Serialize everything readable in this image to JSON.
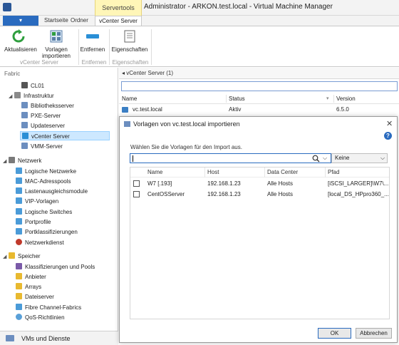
{
  "titlebar": {
    "title": "Administrator - ARKON.test.local - Virtual Machine Manager",
    "context_tab": "Servertools"
  },
  "ribbon": {
    "tabs": [
      "Startseite",
      "Ordner",
      "vCenter Server"
    ],
    "active_tab": "vCenter Server",
    "buttons": {
      "refresh": "Aktualisieren",
      "import_templates_l1": "Vorlagen",
      "import_templates_l2": "importieren",
      "remove": "Entfernen",
      "properties": "Eigenschaften"
    },
    "groups": {
      "vcenter": "vCenter Server",
      "remove": "Entfernen",
      "properties": "Eigenschaften"
    }
  },
  "nav": {
    "header": "Fabric",
    "items": [
      {
        "label": "CL01",
        "level": 2
      },
      {
        "label": "Infrastruktur",
        "level": 1
      },
      {
        "label": "Bibliotheksserver",
        "level": 2
      },
      {
        "label": "PXE-Server",
        "level": 2
      },
      {
        "label": "Updateserver",
        "level": 2
      },
      {
        "label": "vCenter Server",
        "level": 2,
        "selected": true
      },
      {
        "label": "VMM-Server",
        "level": 2
      },
      {
        "label": "Netzwerk",
        "level": 1
      },
      {
        "label": "Logische Netzwerke",
        "level": 2
      },
      {
        "label": "MAC-Adresspools",
        "level": 2
      },
      {
        "label": "Lastenausgleichsmodule",
        "level": 2
      },
      {
        "label": "VIP-Vorlagen",
        "level": 2
      },
      {
        "label": "Logische Switches",
        "level": 2
      },
      {
        "label": "Portprofile",
        "level": 2
      },
      {
        "label": "Portklassifizierungen",
        "level": 2
      },
      {
        "label": "Netzwerkdienst",
        "level": 2
      },
      {
        "label": "Speicher",
        "level": 1
      },
      {
        "label": "Klassifizierungen und Pools",
        "level": 2
      },
      {
        "label": "Anbieter",
        "level": 2
      },
      {
        "label": "Arrays",
        "level": 2
      },
      {
        "label": "Dateiserver",
        "level": 2
      },
      {
        "label": "Fibre Channel-Fabrics",
        "level": 2
      },
      {
        "label": "QoS-Richtlinien",
        "level": 2
      }
    ],
    "bottom_label": "VMs und Dienste"
  },
  "main": {
    "header": "vCenter Server (1)",
    "columns": [
      "Name",
      "Status",
      "Version"
    ],
    "rows": [
      {
        "name": "vc.test.local",
        "status": "Aktiv",
        "version": "6.5.0"
      }
    ]
  },
  "dialog": {
    "title": "Vorlagen von vc.test.local importieren",
    "instruction": "Wählen Sie die Vorlagen für den Import aus.",
    "filter_value": "Keine",
    "columns": [
      "Name",
      "Host",
      "Data Center",
      "Pfad"
    ],
    "rows": [
      {
        "name": "W7 [.193]",
        "host": "192.168.1.23",
        "datacenter": "Alle Hosts",
        "path": "[iSCSI_LARGER]\\W7\\..."
      },
      {
        "name": "CentOSServer",
        "host": "192.168.1.23",
        "datacenter": "Alle Hosts",
        "path": "[local_DS_HPpro360_..."
      }
    ],
    "ok_label": "OK",
    "cancel_label": "Abbrechen"
  },
  "colors": {
    "accent": "#2a6bbf",
    "selection": "#cde8ff",
    "context_tab": "#fff6b8"
  }
}
